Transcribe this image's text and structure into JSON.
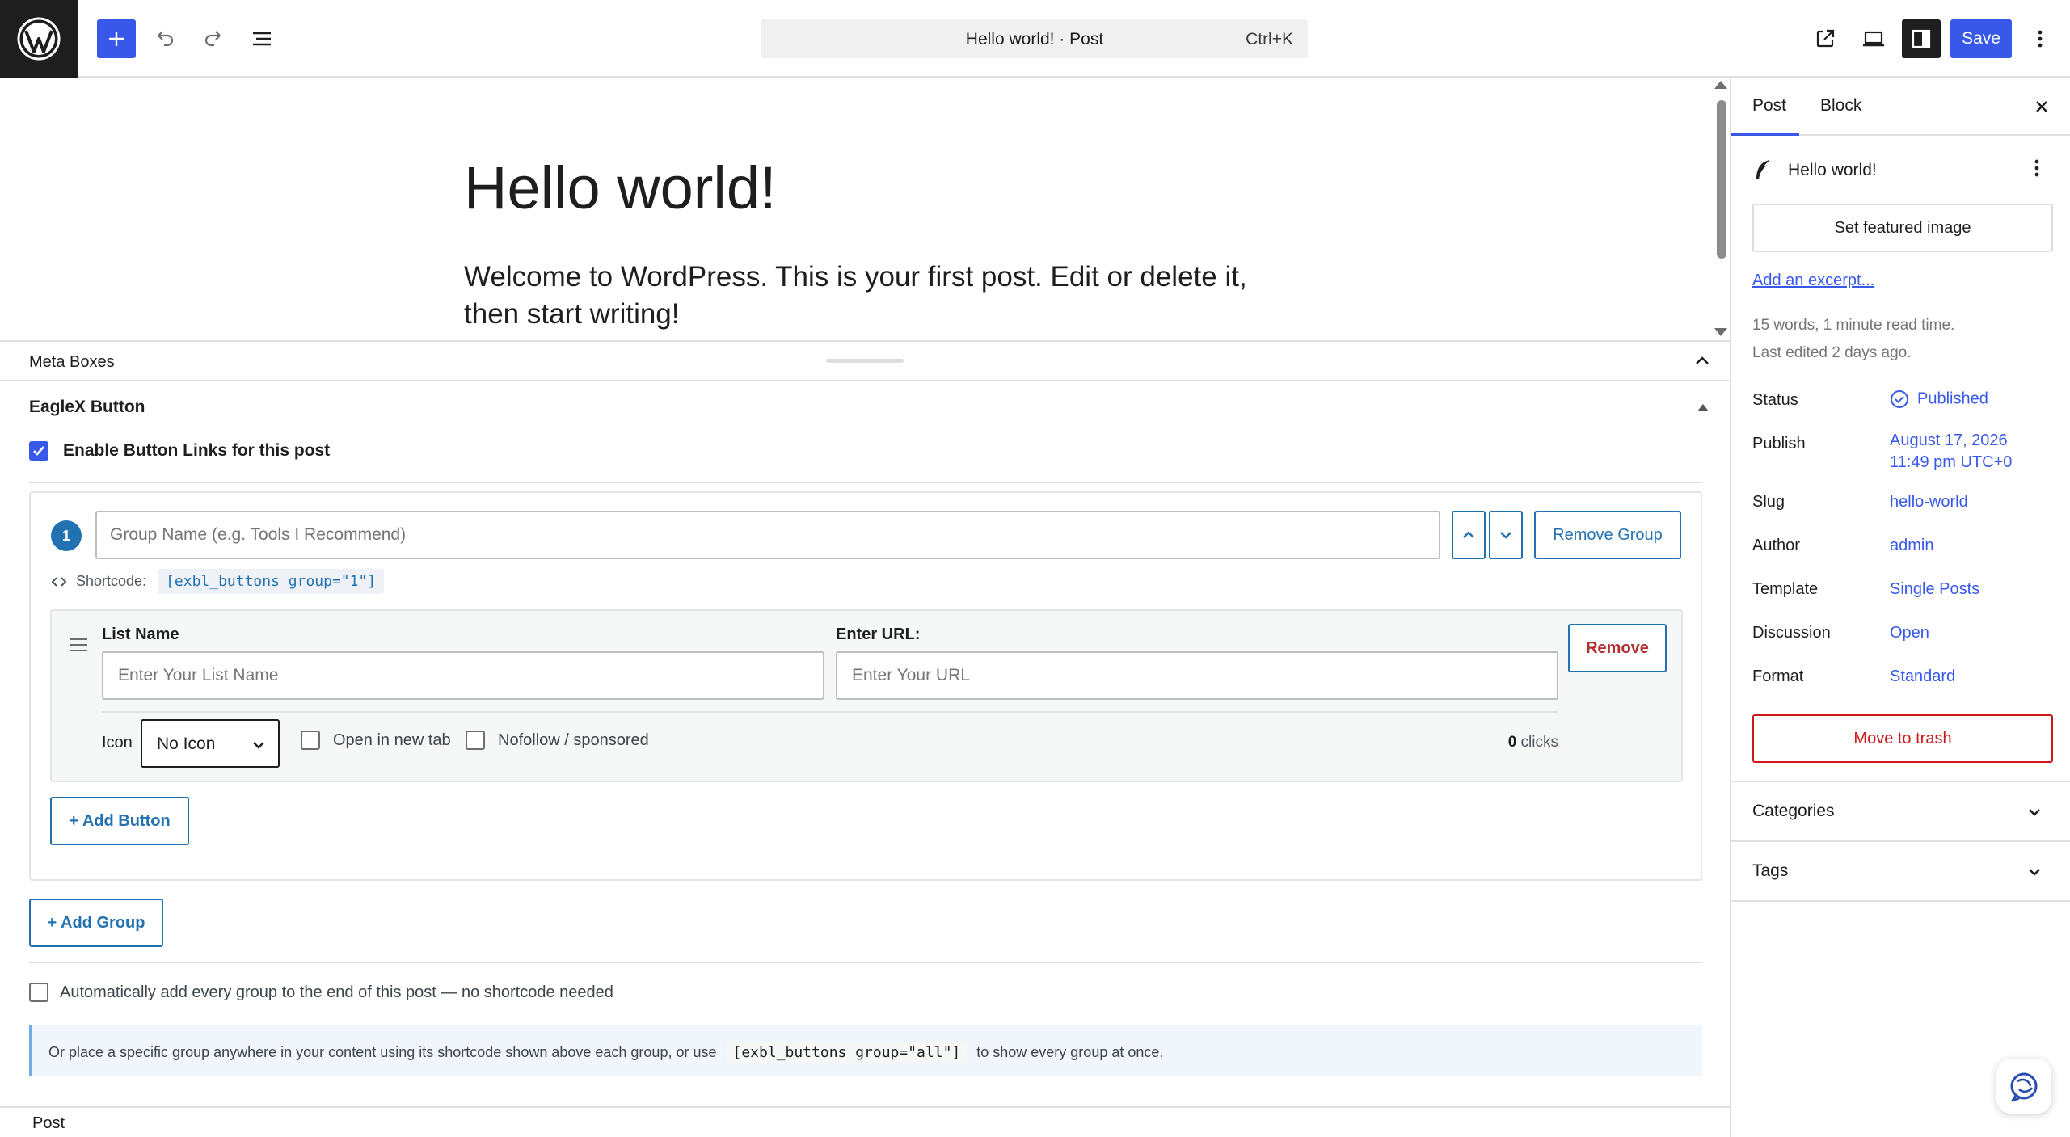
{
  "topbar": {
    "command_title": "Hello world! · Post",
    "command_shortcut": "Ctrl+K",
    "save_label": "Save"
  },
  "canvas": {
    "title": "Hello world!",
    "paragraph": "Welcome to WordPress. This is your first post. Edit or delete it, then start writing!"
  },
  "meta": {
    "header": "Meta Boxes",
    "box_title": "EagleX Button",
    "enable_label": "Enable Button Links for this post",
    "group": {
      "number": "1",
      "name_placeholder": "Group Name (e.g. Tools I Recommend)",
      "remove_group_label": "Remove Group",
      "shortcode_label": "Shortcode:",
      "shortcode": "[exbl_buttons group=\"1\"]",
      "item": {
        "list_name_label": "List Name",
        "list_name_placeholder": "Enter Your List Name",
        "url_label": "Enter URL:",
        "url_placeholder": "Enter Your URL",
        "remove_label": "Remove",
        "icon_label": "Icon",
        "icon_value": "No Icon",
        "open_new_tab_label": "Open in new tab",
        "nofollow_label": "Nofollow / sponsored",
        "clicks_count": "0",
        "clicks_label": "clicks"
      },
      "add_button_label": "+ Add Button"
    },
    "add_group_label": "+ Add Group",
    "auto_add_label": "Automatically add every group to the end of this post — no shortcode needed",
    "info_prefix": "Or place a specific group anywhere in your content using its shortcode shown above each group, or use",
    "info_code": "[exbl_buttons group=\"all\"]",
    "info_suffix": "to show every group at once."
  },
  "footer": {
    "breadcrumb": "Post"
  },
  "sidebar": {
    "tab_post": "Post",
    "tab_block": "Block",
    "post_name": "Hello world!",
    "featured_image_label": "Set featured image",
    "excerpt_link": "Add an excerpt...",
    "read_time": "15 words, 1 minute read time.",
    "last_edited": "Last edited 2 days ago.",
    "rows": {
      "status_label": "Status",
      "status_value": "Published",
      "publish_label": "Publish",
      "publish_date": "August 17, 2026",
      "publish_time": "11:49 pm UTC+0",
      "slug_label": "Slug",
      "slug_value": "hello-world",
      "author_label": "Author",
      "author_value": "admin",
      "template_label": "Template",
      "template_value": "Single Posts",
      "discussion_label": "Discussion",
      "discussion_value": "Open",
      "format_label": "Format",
      "format_value": "Standard"
    },
    "trash_label": "Move to trash",
    "categories_label": "Categories",
    "tags_label": "Tags"
  },
  "colors": {
    "accent": "#3858e9",
    "plugin_blue": "#2271b1",
    "danger": "#cc1818"
  }
}
